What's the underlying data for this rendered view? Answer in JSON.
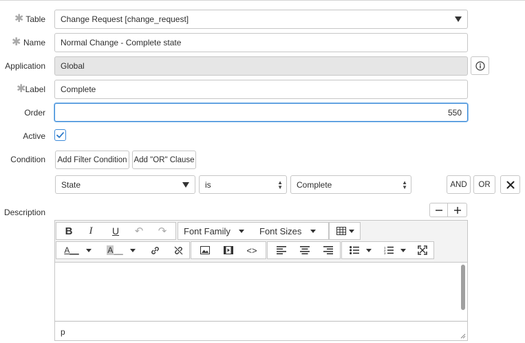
{
  "form": {
    "table": {
      "label": "Table",
      "required": true,
      "value": "Change Request [change_request]"
    },
    "name": {
      "label": "Name",
      "required": true,
      "value": "Normal Change - Complete state"
    },
    "application": {
      "label": "Application",
      "value": "Global"
    },
    "label_field": {
      "label": "Label",
      "required": true,
      "value": "Complete"
    },
    "order": {
      "label": "Order",
      "value": "550"
    },
    "active": {
      "label": "Active",
      "checked": true
    },
    "condition": {
      "label": "Condition",
      "add_filter_label": "Add Filter Condition",
      "add_or_label": "Add \"OR\" Clause",
      "field_value": "State",
      "operator_value": "is",
      "value_value": "Complete",
      "and_label": "AND",
      "or_label": "OR"
    },
    "description": {
      "label": "Description",
      "font_family_label": "Font Family",
      "font_sizes_label": "Font Sizes",
      "status_path": "p"
    }
  },
  "icons": {
    "required": "asterisk-icon",
    "info": "info-icon",
    "remove": "close-icon",
    "check": "checkmark-icon"
  },
  "colors": {
    "focus": "#3b8ad9",
    "readonly_bg": "#e6e6e6",
    "border": "#c6c6c6"
  }
}
